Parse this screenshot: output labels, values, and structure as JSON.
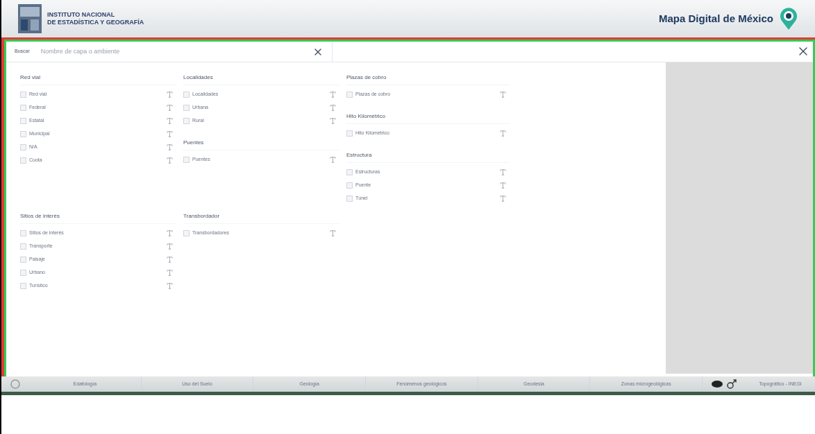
{
  "header": {
    "institution": [
      "INSTITUTO NACIONAL",
      "DE ESTADÍSTICA Y GEOGRAFÍA"
    ],
    "app_title": "Mapa Digital de México"
  },
  "search": {
    "label": "Buscar",
    "placeholder": "Nombre de capa o ambiente"
  },
  "layer_rows": [
    {
      "columns": [
        [
          {
            "title": "Red vial",
            "layers": [
              {
                "name": "Red vial",
                "checked": false
              },
              {
                "name": "Federal",
                "checked": false
              },
              {
                "name": "Estatal",
                "checked": false
              },
              {
                "name": "Municipal",
                "checked": false
              },
              {
                "name": "N/A",
                "checked": false
              },
              {
                "name": "Cuota",
                "checked": false
              }
            ]
          }
        ],
        [
          {
            "title": "Localidades",
            "layers": [
              {
                "name": "Localidades",
                "checked": false
              },
              {
                "name": "Urbana",
                "checked": false
              },
              {
                "name": "Rural",
                "checked": false
              }
            ]
          },
          {
            "title": "Puentes",
            "layers": [
              {
                "name": "Puentes",
                "checked": false
              }
            ]
          }
        ],
        [
          {
            "title": "Plazas de cobro",
            "layers": [
              {
                "name": "Plazas de cobro",
                "checked": false
              }
            ]
          },
          {
            "title": "Hito Kilométrico",
            "layers": [
              {
                "name": "Hito Kilométrico",
                "checked": false
              }
            ]
          },
          {
            "title": "Estructura",
            "layers": [
              {
                "name": "Estructuras",
                "checked": false
              },
              {
                "name": "Puente",
                "checked": false
              },
              {
                "name": "Túnel",
                "checked": false
              }
            ]
          }
        ]
      ]
    },
    {
      "columns": [
        [
          {
            "title": "Sitios de interés",
            "layers": [
              {
                "name": "Sitios de interés",
                "checked": false
              },
              {
                "name": "Transporte",
                "checked": false
              },
              {
                "name": "Paisaje",
                "checked": false
              },
              {
                "name": "Urbano",
                "checked": false
              },
              {
                "name": "Turístico",
                "checked": false
              }
            ]
          }
        ],
        [
          {
            "title": "Transbordador",
            "layers": [
              {
                "name": "Transbordadores",
                "checked": false
              }
            ]
          }
        ],
        []
      ]
    }
  ],
  "bottom_tabs": [
    "Edafología",
    "Uso del Suelo",
    "Geología",
    "Fenómenos geológicos",
    "Geodesia",
    "Zonas microgeológicas"
  ],
  "basemap": "Topográfico - INEGI"
}
